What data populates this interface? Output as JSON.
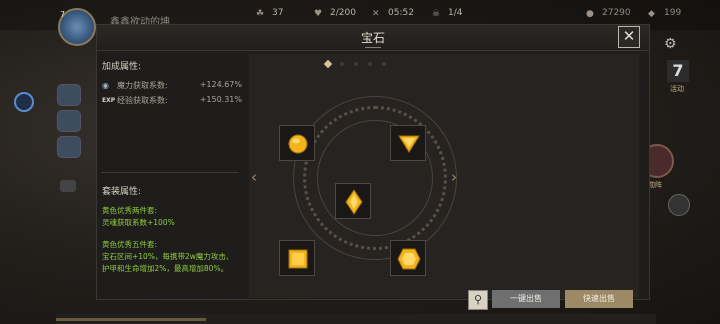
{
  "hud": {
    "player_level": "7",
    "player_name": "鑫鑫欲动的坤",
    "stat_1": "37",
    "stat_2": "2/200",
    "timer": "05:52",
    "stat_4": "1/4",
    "currency_1": "27290",
    "currency_2": "199",
    "level_badge": "7",
    "right_label_1": "活动",
    "right_label_2": "勋阵"
  },
  "modal": {
    "title": "宝石",
    "close_glyph": "✕"
  },
  "bonus": {
    "title": "加成属性:",
    "rows": [
      {
        "icon": "magic-orb-icon",
        "label": "魔力获取系数:",
        "value": "+124.67%"
      },
      {
        "icon": "exp-icon",
        "icon_text": "EXP",
        "label": "经验获取系数:",
        "value": "+150.31%"
      }
    ]
  },
  "set_bonus": {
    "title": "套装属性:",
    "two_piece_title": "黄色优秀两件套:",
    "two_piece_text": "灵魂获取系数+100%",
    "five_piece_title": "黄色优秀五件套:",
    "five_piece_line1": "宝石区间+10%，每携带2w魔力攻击、",
    "five_piece_line2": "护甲和生命增加2%，最高增加80%。"
  },
  "gems": {
    "page_dots": 5,
    "active_dot": 0,
    "slots": [
      {
        "name": "gem-slot-circle",
        "shape": "circle",
        "color": "#f2b31c"
      },
      {
        "name": "gem-slot-triangle",
        "shape": "triangle",
        "color": "#f2b31c"
      },
      {
        "name": "gem-slot-diamond",
        "shape": "diamond",
        "color": "#f2b31c"
      },
      {
        "name": "gem-slot-square",
        "shape": "square",
        "color": "#f2b31c"
      },
      {
        "name": "gem-slot-hexagon",
        "shape": "hexagon",
        "color": "#f2b31c"
      }
    ],
    "left_arrow": "‹",
    "right_arrow": "›"
  },
  "actions": {
    "filter_glyph": "⚲",
    "sell_all": "一键出售",
    "quick_sell": "快速出售"
  },
  "colors": {
    "accent_gold": "#9c8a66",
    "gem_yellow": "#f2b31c",
    "set_text_green": "#8fce3f"
  }
}
